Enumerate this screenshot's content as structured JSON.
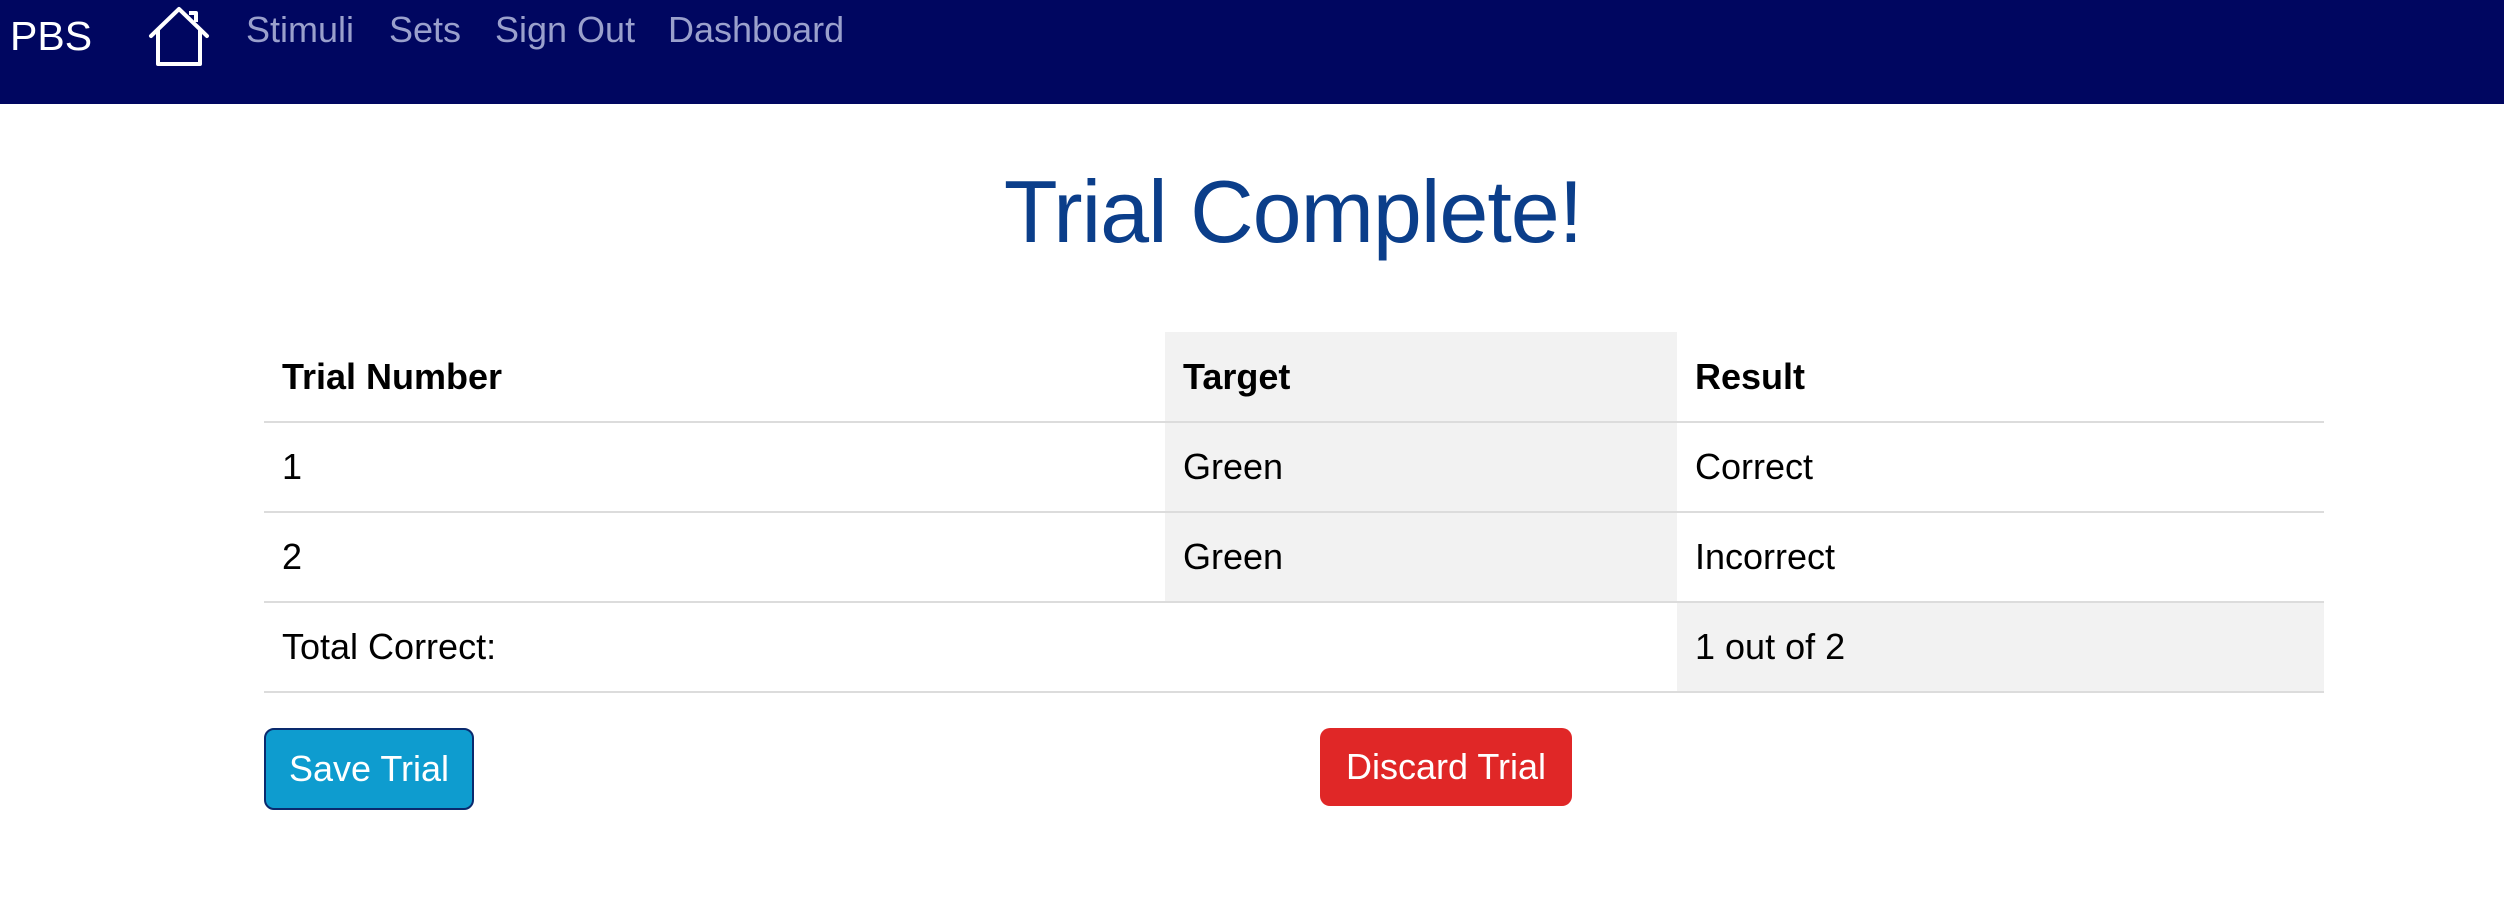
{
  "navbar": {
    "brand": "PBS",
    "home_icon": "home-icon",
    "links": [
      "Stimuli",
      "Sets",
      "Sign Out",
      "Dashboard"
    ],
    "background_color": "#000660"
  },
  "page": {
    "title": "Trial Complete!"
  },
  "table": {
    "headers": [
      "Trial Number",
      "Target",
      "Result"
    ],
    "rows": [
      [
        "1",
        "Green",
        "Correct"
      ],
      [
        "2",
        "Green",
        "Incorrect"
      ]
    ],
    "total_label": "Total Correct:",
    "total_value": "1 out of 2"
  },
  "actions": {
    "save_label": "Save Trial",
    "discard_label": "Discard Trial",
    "save_color": "#0e9ccf",
    "discard_color": "#e02727"
  }
}
